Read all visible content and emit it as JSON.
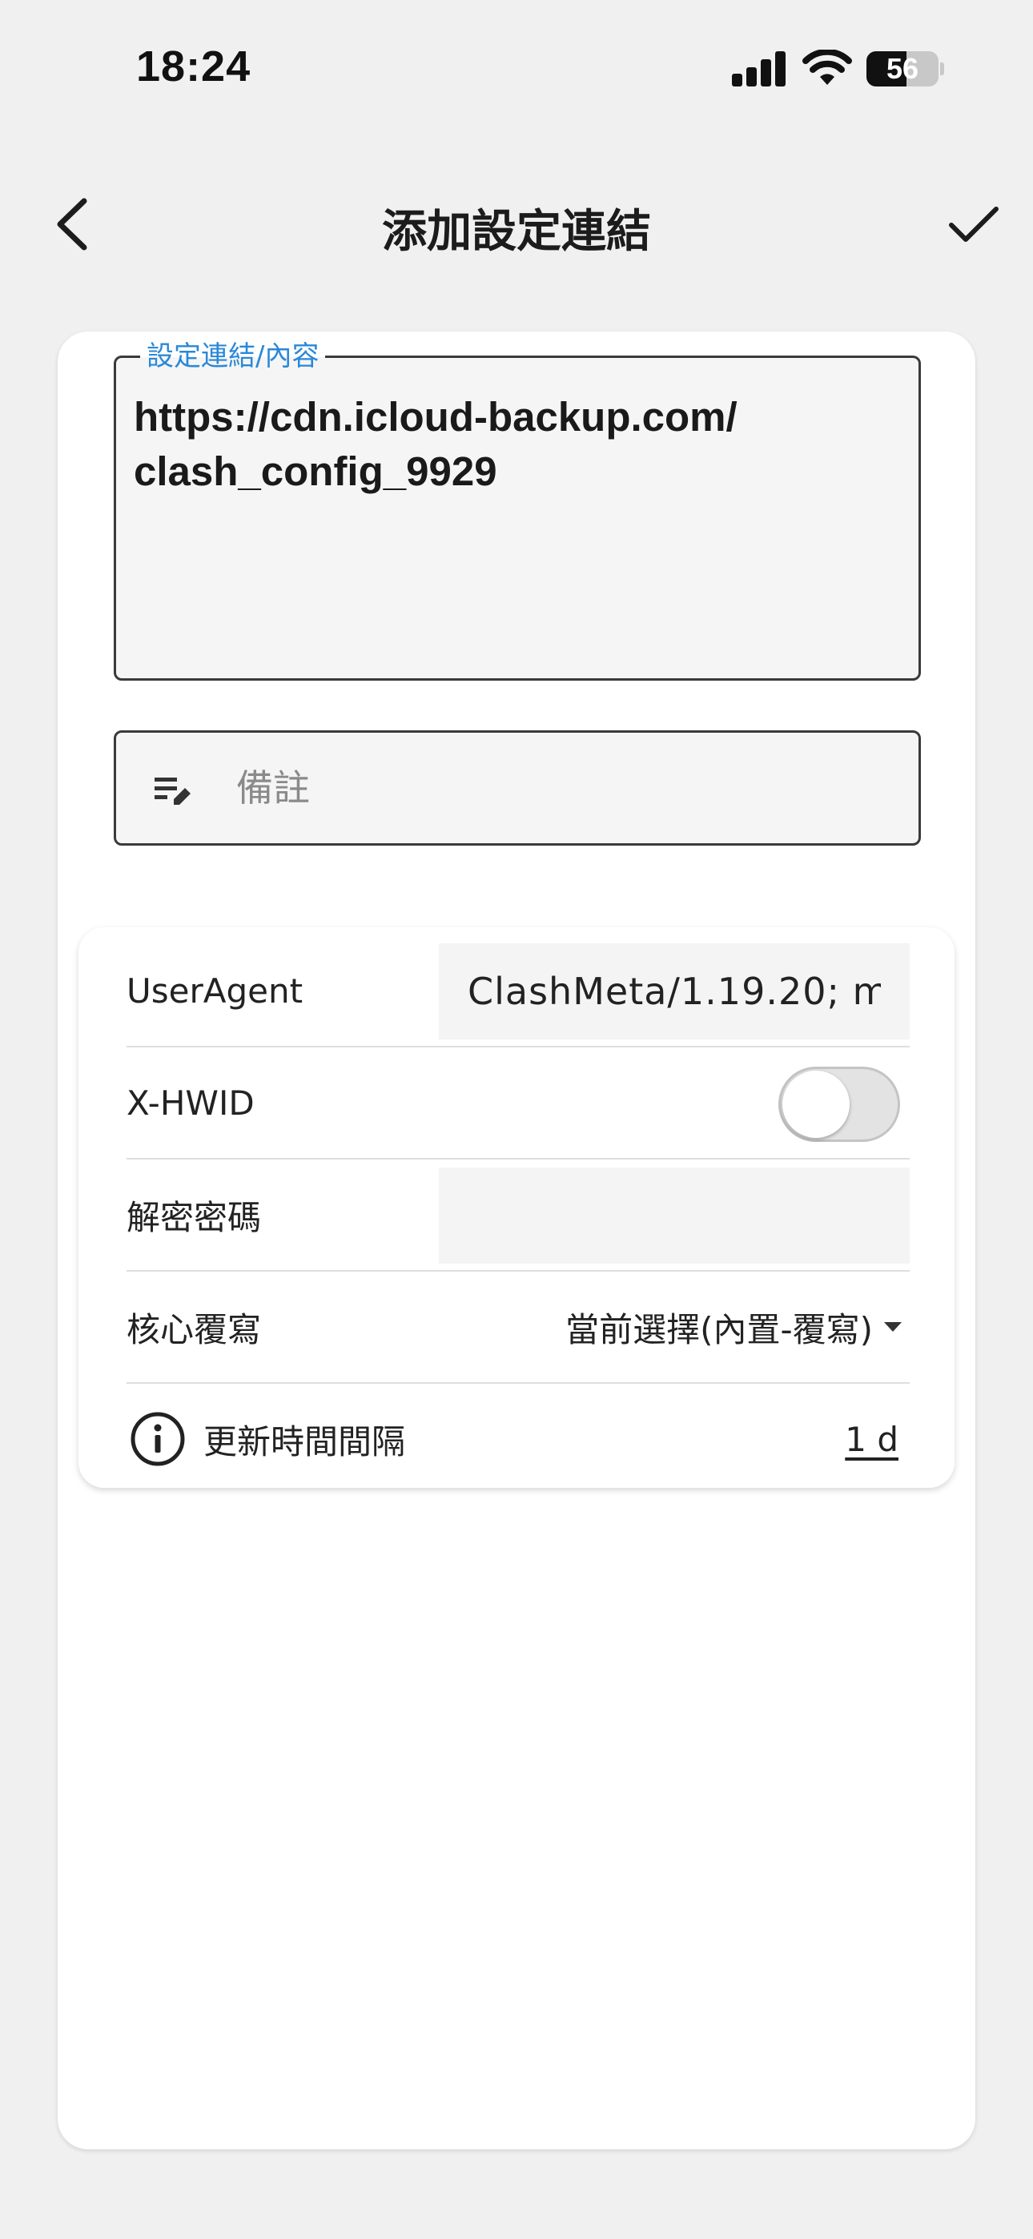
{
  "status_bar": {
    "time": "18:24",
    "battery_level": "56",
    "icons": [
      "cellular-signal-icon",
      "wifi-icon",
      "battery-icon"
    ]
  },
  "app_bar": {
    "title": "添加設定連結",
    "back_icon": "chevron-left-icon",
    "confirm_icon": "checkmark-icon"
  },
  "url_field": {
    "label": "設定連結/內容",
    "value": "https://cdn.icloud-backup.com/\nclash_config_9929"
  },
  "note_field": {
    "placeholder": "備註",
    "value": "",
    "icon": "edit-note-icon"
  },
  "settings": {
    "user_agent": {
      "label": "UserAgent",
      "value": "ClashMeta/1.19.20; m"
    },
    "x_hwid": {
      "label": "X-HWID",
      "enabled": false
    },
    "decrypt_password": {
      "label": "解密密碼",
      "value": ""
    },
    "core_override": {
      "label": "核心覆寫",
      "selected": "當前選擇(內置-覆寫)"
    },
    "update_interval": {
      "label": "更新時間間隔",
      "value": "1 d",
      "icon": "info-icon"
    }
  },
  "colors": {
    "background": "#f0f0f0",
    "surface": "#ffffff",
    "field_fill": "#f5f5f5",
    "accent_label": "#2a88d8",
    "text": "#1c1c1c"
  }
}
